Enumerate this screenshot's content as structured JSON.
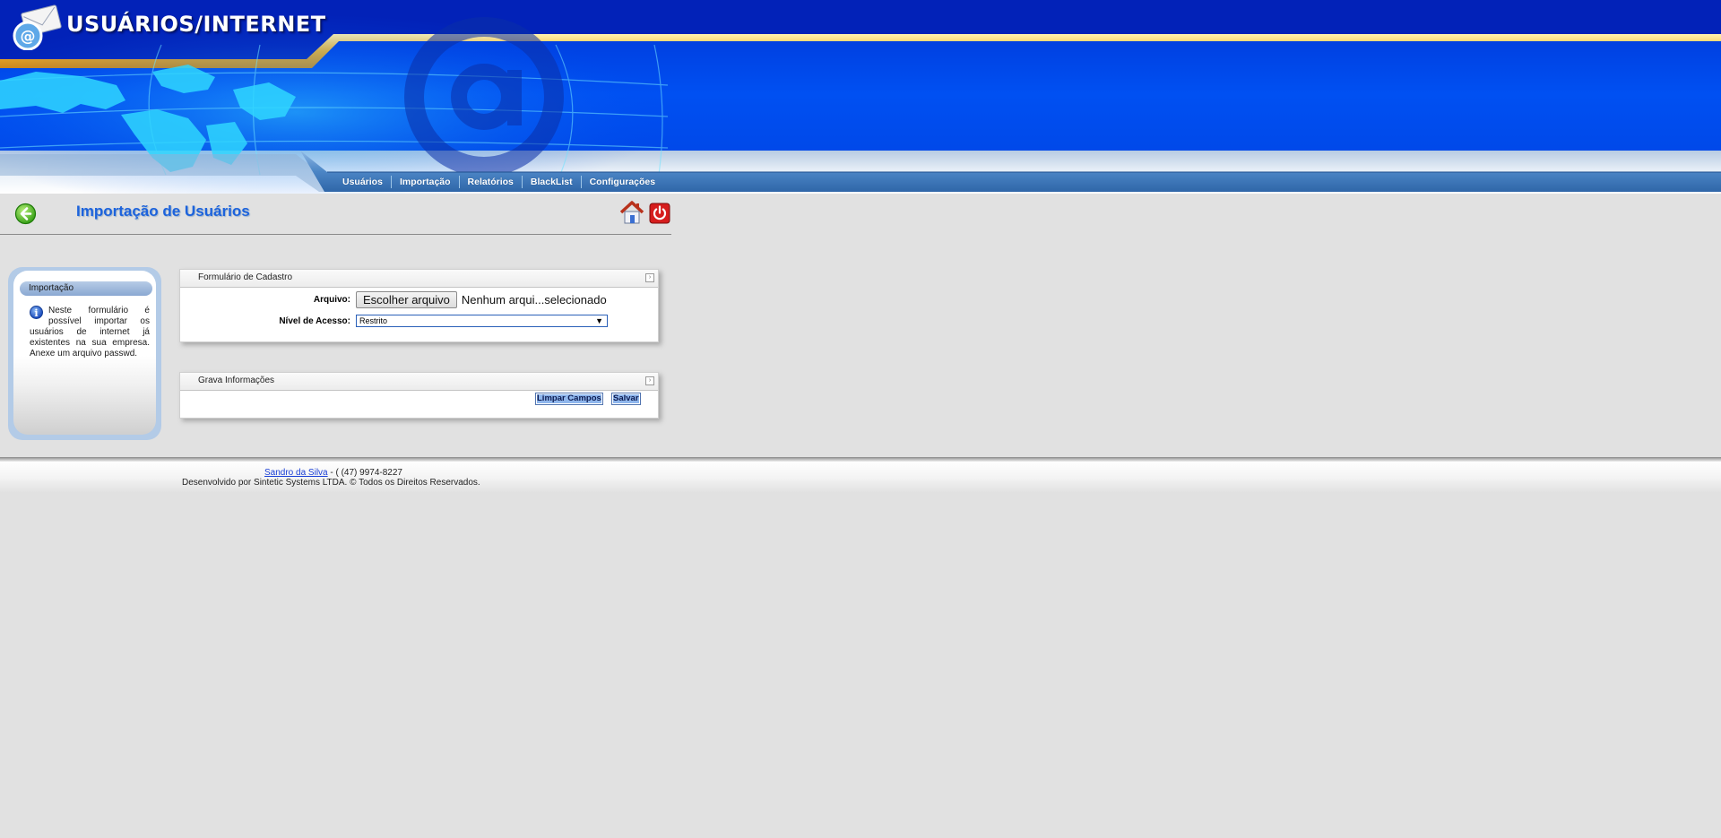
{
  "app": {
    "title": "USUÁRIOS/INTERNET"
  },
  "nav": {
    "items": [
      {
        "label": "Usuários"
      },
      {
        "label": "Importação"
      },
      {
        "label": "Relatórios"
      },
      {
        "label": "BlackList"
      },
      {
        "label": "Configurações"
      }
    ]
  },
  "page": {
    "title": "Importação de Usuários"
  },
  "sidebar_box": {
    "title": "Importação",
    "icon": "info-icon",
    "text": "Neste formulário é possível importar os usuários de internet já existentes na sua empresa. Anexe um arquivo passwd."
  },
  "cadastro_panel": {
    "title": "Formulário de Cadastro",
    "file_label": "Arquivo:",
    "file_button": "Escolher arquivo",
    "file_status": "Nenhum arqui...selecionado",
    "access_label": "Nível de Acesso:",
    "access_value": "Restrito"
  },
  "grava_panel": {
    "title": "Grava Informações",
    "clear_button": "Limpar Campos",
    "save_button": "Salvar"
  },
  "footer": {
    "author_link": "Sandro da Silva",
    "phone": " - ( (47) 9974-8227",
    "credits": "Desenvolvido por Sintetic Systems LTDA. © Todos os Direitos Reservados."
  },
  "colors": {
    "banner_blue": "#0046e6",
    "title_blue": "#1d63dc",
    "accent_gold": "#f5b52c",
    "nav_band": "#3f7fc0",
    "page_background": "#e1e1e1"
  }
}
